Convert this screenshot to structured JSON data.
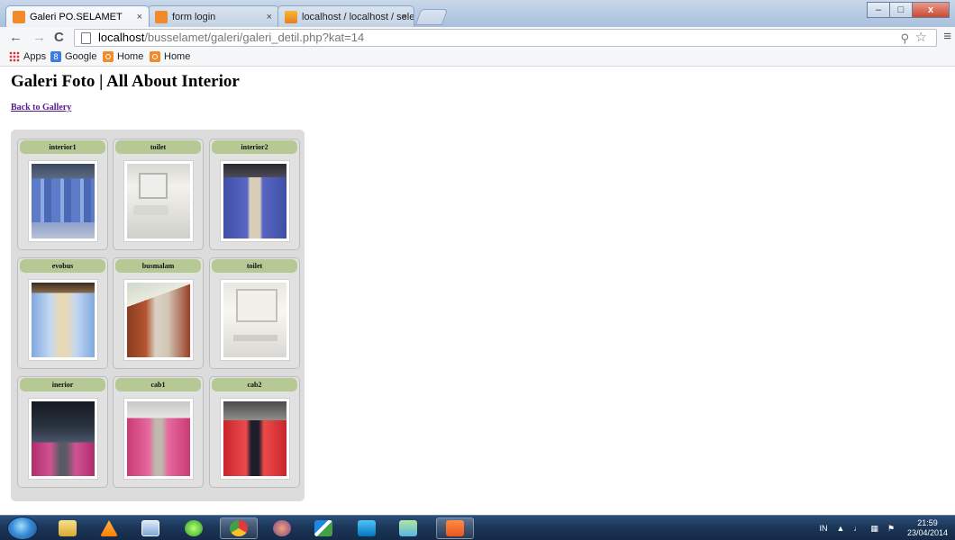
{
  "browser": {
    "tabs": [
      {
        "label": "Galeri PO.SELAMET",
        "close": "×",
        "active": true
      },
      {
        "label": "form login",
        "close": "×",
        "active": false
      },
      {
        "label": "localhost / localhost / sele",
        "close": "×",
        "active": false
      }
    ],
    "window_controls": {
      "minimize": "–",
      "maximize": "□",
      "close": "x"
    },
    "url_host": "localhost",
    "url_path": "/busselamet/galeri/galeri_detil.php?kat=14",
    "bookmarks": [
      "Apps",
      "Google",
      "Home",
      "Home"
    ]
  },
  "page": {
    "title": "Galeri Foto | All About Interior",
    "back_link": "Back to Gallery",
    "items": [
      {
        "title": "interior1"
      },
      {
        "title": "toilet"
      },
      {
        "title": "interior2"
      },
      {
        "title": "evobus"
      },
      {
        "title": "busmalam"
      },
      {
        "title": "toilet"
      },
      {
        "title": "inerior"
      },
      {
        "title": "cab1"
      },
      {
        "title": "cab2"
      }
    ]
  },
  "taskbar": {
    "language": "IN",
    "time": "21:59",
    "date": "23/04/2014"
  },
  "icons": [
    "back-arrow-icon",
    "forward-arrow-icon",
    "reload-icon",
    "page-icon",
    "zoom-icon",
    "star-icon",
    "menu-icon",
    "windows-start-icon"
  ]
}
